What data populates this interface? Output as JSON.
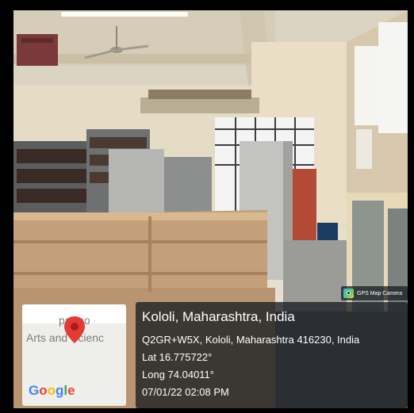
{
  "badge": {
    "text": "GPS Map Camera",
    "icon": "gps-map-camera-icon"
  },
  "location": {
    "title": "Kololi, Maharashtra, India",
    "plus_code": "Q2GR+W5X, Kololi, Maharashtra 416230, India",
    "lat": "Lat 16.775722°",
    "long": "Long 74.04011°",
    "datetime": "07/01/22 02:08 PM"
  },
  "map": {
    "label_top": "patrao",
    "label_bottom": "Arts and Scienc",
    "brand": "Google",
    "pin_color": "#e53935"
  }
}
